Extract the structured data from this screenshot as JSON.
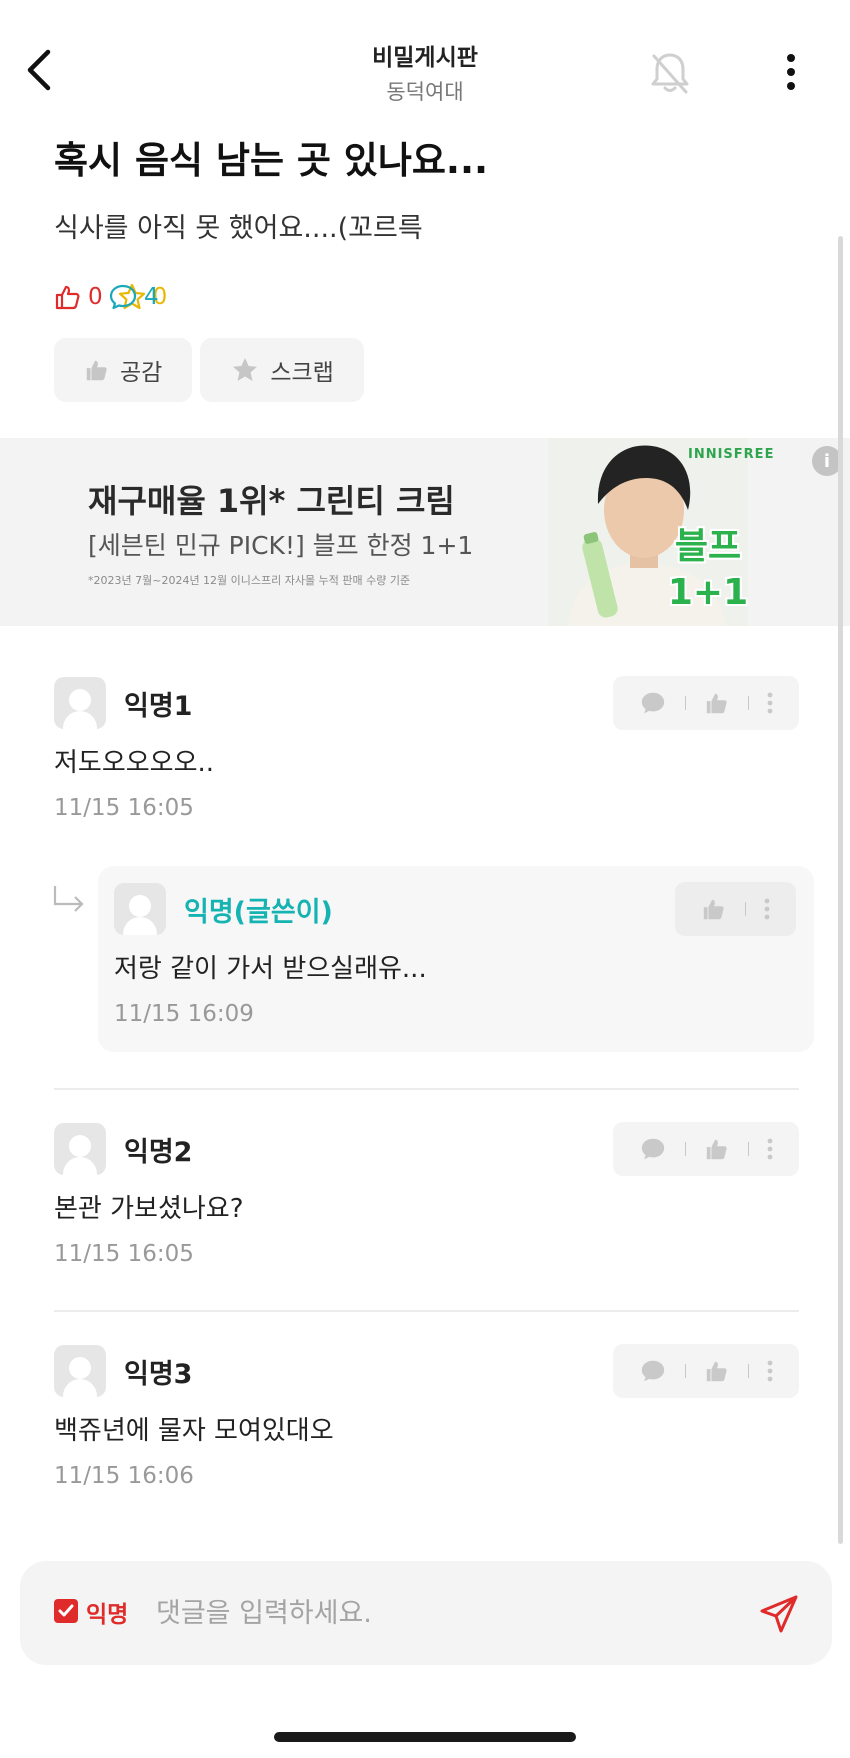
{
  "header": {
    "board_name": "비밀게시판",
    "school_name": "동덕여대",
    "back_icon": "chevron-left-icon",
    "notification_icon": "bell-off-icon",
    "more_icon": "kebab-menu-icon"
  },
  "post": {
    "title": "혹시 음식 남는 곳 있나요...",
    "body": "식사를 아직 못 했어요....(꼬르륵",
    "stats": {
      "likes": "0",
      "comments": "4",
      "scraps": "0"
    },
    "like_button": "공감",
    "scrap_button": "스크랩"
  },
  "ad": {
    "headline": "재구매율 1위* 그린티 크림",
    "subline": "[세븐틴 민규 PICK!] 블프 한정 1+1",
    "fine_print": "*2023년 7월~2024년 12월 이니스프리 자사몰 누적 판매 수량 기준",
    "brand": "INNISFREE",
    "badge_line1": "블프",
    "badge_line2": "1+1",
    "info_icon": "info-icon"
  },
  "comments": [
    {
      "author": "익명1",
      "text": "저도오오오오..",
      "time": "11/15 16:05"
    },
    {
      "author": "익명2",
      "text": "본관 가보셨나요?",
      "time": "11/15 16:05"
    },
    {
      "author": "익명3",
      "text": "백쥬년에 물자 모여있대오",
      "time": "11/15 16:06"
    }
  ],
  "reply": {
    "author": "익명(글쓴이)",
    "text": "저랑 같이 가서 받으실래유...",
    "time": "11/15 16:09"
  },
  "composer": {
    "anonymous_label": "익명",
    "anonymous_checked": true,
    "placeholder": "댓글을 입력하세요.",
    "send_icon": "send-icon"
  },
  "colors": {
    "accent_red": "#e02b2b",
    "writer_teal": "#16b3b3",
    "comment_teal": "#1aa8b8",
    "scrap_yellow": "#e8b800",
    "ad_green": "#2bb24c"
  }
}
